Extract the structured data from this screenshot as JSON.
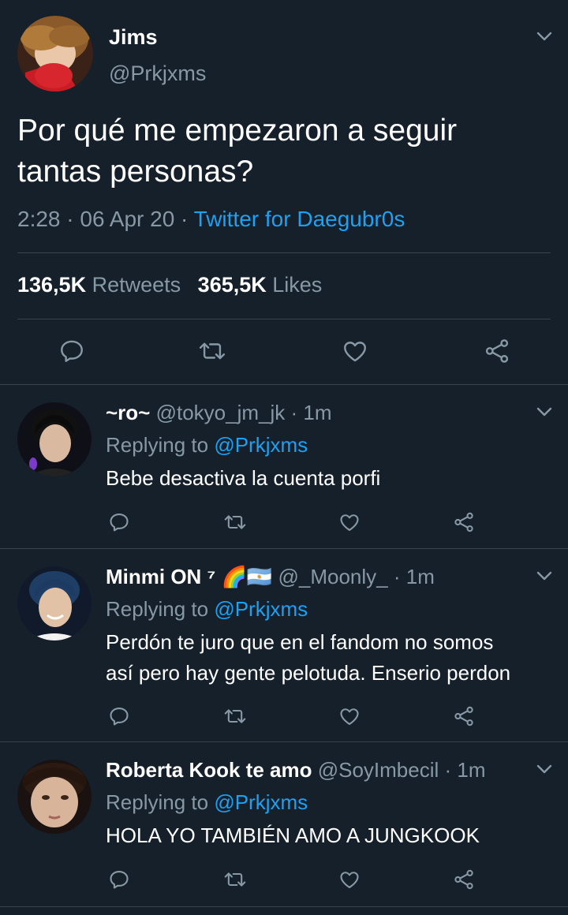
{
  "main_tweet": {
    "display_name": "Jims",
    "handle": "@Prkjxms",
    "text_line1": "Por qué me empezaron a seguir",
    "text_line2": "tantas personas?",
    "time": "2:28",
    "sep1": "·",
    "date": "06 Apr 20",
    "sep2": "·",
    "source": "Twitter for Daegubr0s",
    "retweets_count": "136,5K",
    "retweets_label": "Retweets",
    "likes_count": "365,5K",
    "likes_label": "Likes"
  },
  "replies": [
    {
      "display_name": "~ro~",
      "handle": "@tokyo_jm_jk",
      "time": "· 1m",
      "replying_prefix": "Replying to",
      "replying_to": "@Prkjxms",
      "text_line1": "Bebe desactiva la cuenta porfi",
      "text_line2": ""
    },
    {
      "display_name": "Minmi ON ⁷",
      "emoji_flags": "🌈🇦🇷",
      "handle": "@_Moonly_",
      "time": "· 1m",
      "replying_prefix": "Replying to",
      "replying_to": "@Prkjxms",
      "text_line1": "Perdón te juro que en el fandom no somos",
      "text_line2": "así pero hay gente pelotuda. Enserio perdon"
    },
    {
      "display_name": "Roberta Kook te amo",
      "handle": "@SoyImbecil",
      "time": "· 1m",
      "replying_prefix": "Replying to",
      "replying_to": "@Prkjxms",
      "text_line1": "HOLA YO TAMBIÉN AMO A JUNGKOOK",
      "text_line2": ""
    }
  ],
  "colors": {
    "background": "#15202b",
    "muted": "#8899a6",
    "accent": "#1da1f2",
    "divider": "#38444d"
  },
  "icons": [
    "chevron-down-icon",
    "reply-icon",
    "retweet-icon",
    "like-icon",
    "share-icon"
  ]
}
